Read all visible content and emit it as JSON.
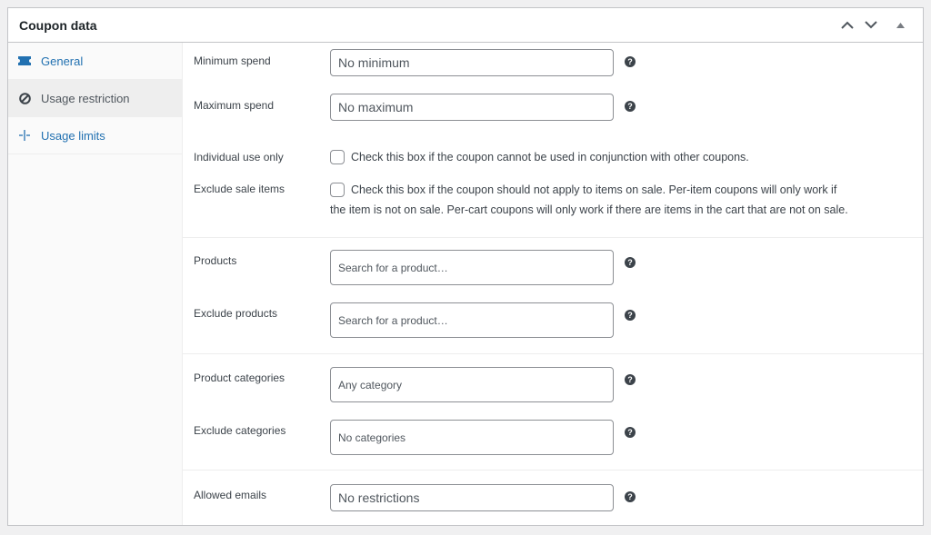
{
  "header": {
    "title": "Coupon data",
    "buttons": [
      "move-up",
      "move-down",
      "collapse"
    ]
  },
  "sidebar": {
    "items": [
      {
        "label": "General",
        "icon": "ticket-icon",
        "active": false
      },
      {
        "label": "Usage restriction",
        "icon": "block-icon",
        "active": true
      },
      {
        "label": "Usage limits",
        "icon": "limits-icon",
        "active": false
      }
    ]
  },
  "fields": {
    "minimum_spend": {
      "label": "Minimum spend",
      "placeholder": "No minimum"
    },
    "maximum_spend": {
      "label": "Maximum spend",
      "placeholder": "No maximum"
    },
    "individual_use": {
      "label": "Individual use only",
      "description": "Check this box if the coupon cannot be used in conjunction with other coupons.",
      "checked": false
    },
    "exclude_sale_items": {
      "label": "Exclude sale items",
      "description_line1": "Check this box if the coupon should not apply to items on sale. Per-item coupons will only work if",
      "description_line2": "the item is not on sale. Per-cart coupons will only work if there are items in the cart that are not on sale.",
      "checked": false
    },
    "products": {
      "label": "Products",
      "placeholder": "Search for a product…"
    },
    "exclude_products": {
      "label": "Exclude products",
      "placeholder": "Search for a product…"
    },
    "product_categories": {
      "label": "Product categories",
      "placeholder": "Any category"
    },
    "exclude_categories": {
      "label": "Exclude categories",
      "placeholder": "No categories"
    },
    "allowed_emails": {
      "label": "Allowed emails",
      "placeholder": "No restrictions"
    }
  },
  "help_glyph": "?"
}
